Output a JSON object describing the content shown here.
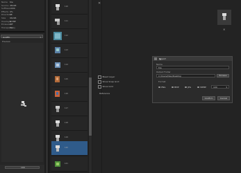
{
  "left_panel": {
    "properties": [
      {
        "key": "Name",
        "value": "tile"
      },
      {
        "key": "Source",
        "value": "48x48"
      },
      {
        "key": "Suffixes",
        "value": "1000"
      },
      {
        "key": "Effects",
        "value": "0%"
      },
      {
        "key": "Direction",
        "value": "SE"
      },
      {
        "key": "Size",
        "value": "96x96"
      },
      {
        "key": "Overlays",
        "value": "NONE"
      },
      {
        "key": "Emission",
        "value": "Off"
      },
      {
        "key": "Transparency",
        "value": "Yes"
      }
    ],
    "tags_select": "Graffiti",
    "preview_label": "Preview",
    "slider_value": "100"
  },
  "tiles": [
    {
      "label": "110"
    },
    {
      "label": "111"
    },
    {
      "label": "112"
    },
    {
      "label": "113"
    },
    {
      "label": "114"
    },
    {
      "label": "115"
    },
    {
      "label": "116"
    },
    {
      "label": "117"
    },
    {
      "label": "118"
    },
    {
      "label": "119"
    },
    {
      "label": "120"
    },
    {
      "label": "121"
    }
  ],
  "main": {
    "checkboxes": [
      {
        "label": "Bleed Layer"
      },
      {
        "label": "Show Snap Grid"
      },
      {
        "label": "Show Grid"
      }
    ],
    "reference_label": "Reference"
  },
  "dialog": {
    "title": "Export",
    "name_label": "Name",
    "name_value": "tile",
    "folder_label": "Output Folder",
    "folder_value": "C:/Users/tiles/Desktop",
    "browse_label": "Browse",
    "format_label": "Format",
    "formats": [
      "PNG",
      "BMP",
      "JPG",
      "WEBP"
    ],
    "selected_format": "WEBP",
    "scale_value": "100",
    "confirm_label": "Confirm",
    "cancel_label": "Cancel"
  }
}
